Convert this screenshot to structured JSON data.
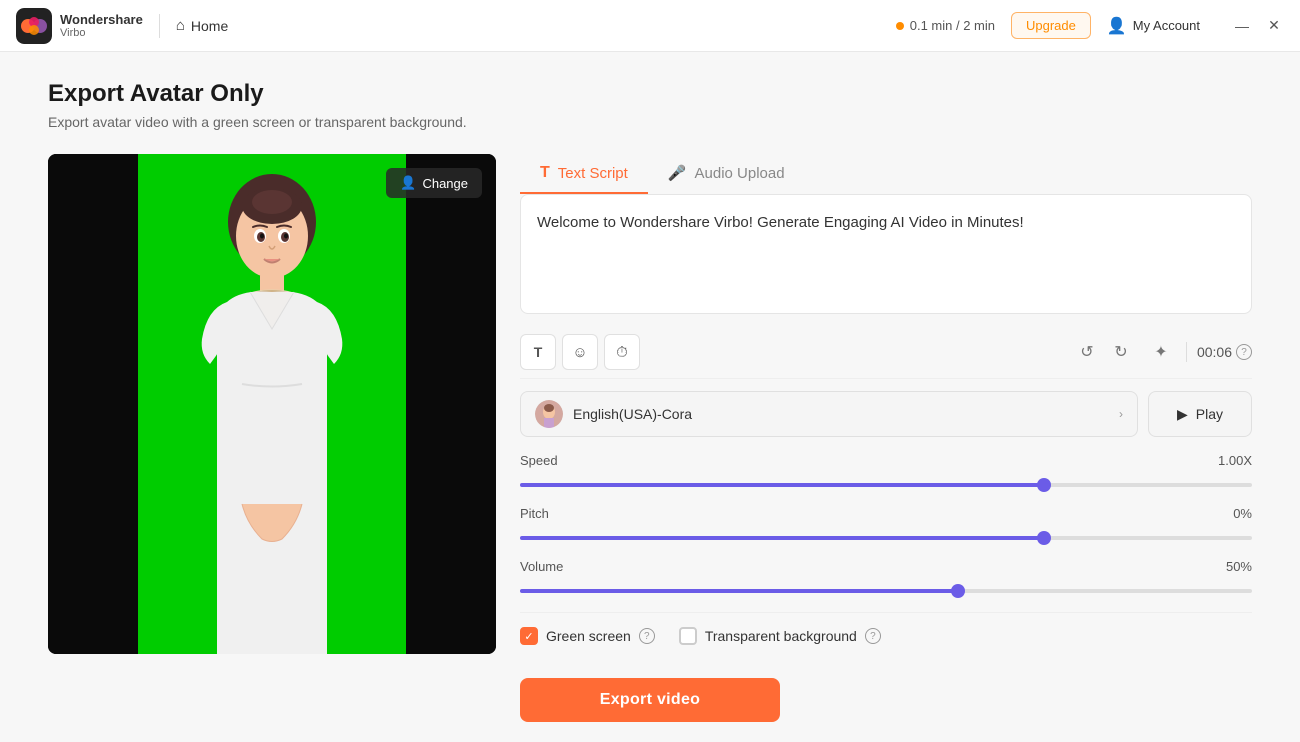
{
  "app": {
    "name": "Wondershare",
    "sub": "Virbo",
    "logo_colors": [
      "#ff6b35",
      "#9b59b6",
      "#e91e63",
      "#ff8c00"
    ]
  },
  "titlebar": {
    "home_label": "Home",
    "usage_label": "0.1 min / 2 min",
    "upgrade_label": "Upgrade",
    "account_label": "My Account"
  },
  "page": {
    "title": "Export Avatar Only",
    "subtitle": "Export avatar video with a green screen or transparent background."
  },
  "video": {
    "change_label": "Change"
  },
  "tabs": [
    {
      "id": "text-script",
      "label": "Text Script",
      "icon": "T",
      "active": true
    },
    {
      "id": "audio-upload",
      "label": "Audio Upload",
      "icon": "mic",
      "active": false
    }
  ],
  "script": {
    "content": "Welcome to Wondershare Virbo! Generate Engaging AI Video in Minutes!"
  },
  "toolbar": {
    "text_icon": "T",
    "face_icon": "☺",
    "clock_icon": "⏱",
    "time_display": "00:06"
  },
  "voice": {
    "name": "English(USA)-Cora",
    "play_label": "Play"
  },
  "speed": {
    "label": "Speed",
    "value": "1.00X",
    "percent": 72
  },
  "pitch": {
    "label": "Pitch",
    "value": "0%",
    "percent": 72
  },
  "volume": {
    "label": "Volume",
    "value": "50%",
    "percent": 60
  },
  "background_options": [
    {
      "id": "green-screen",
      "label": "Green screen",
      "checked": true
    },
    {
      "id": "transparent",
      "label": "Transparent background",
      "checked": false
    }
  ],
  "export": {
    "button_label": "Export video"
  }
}
